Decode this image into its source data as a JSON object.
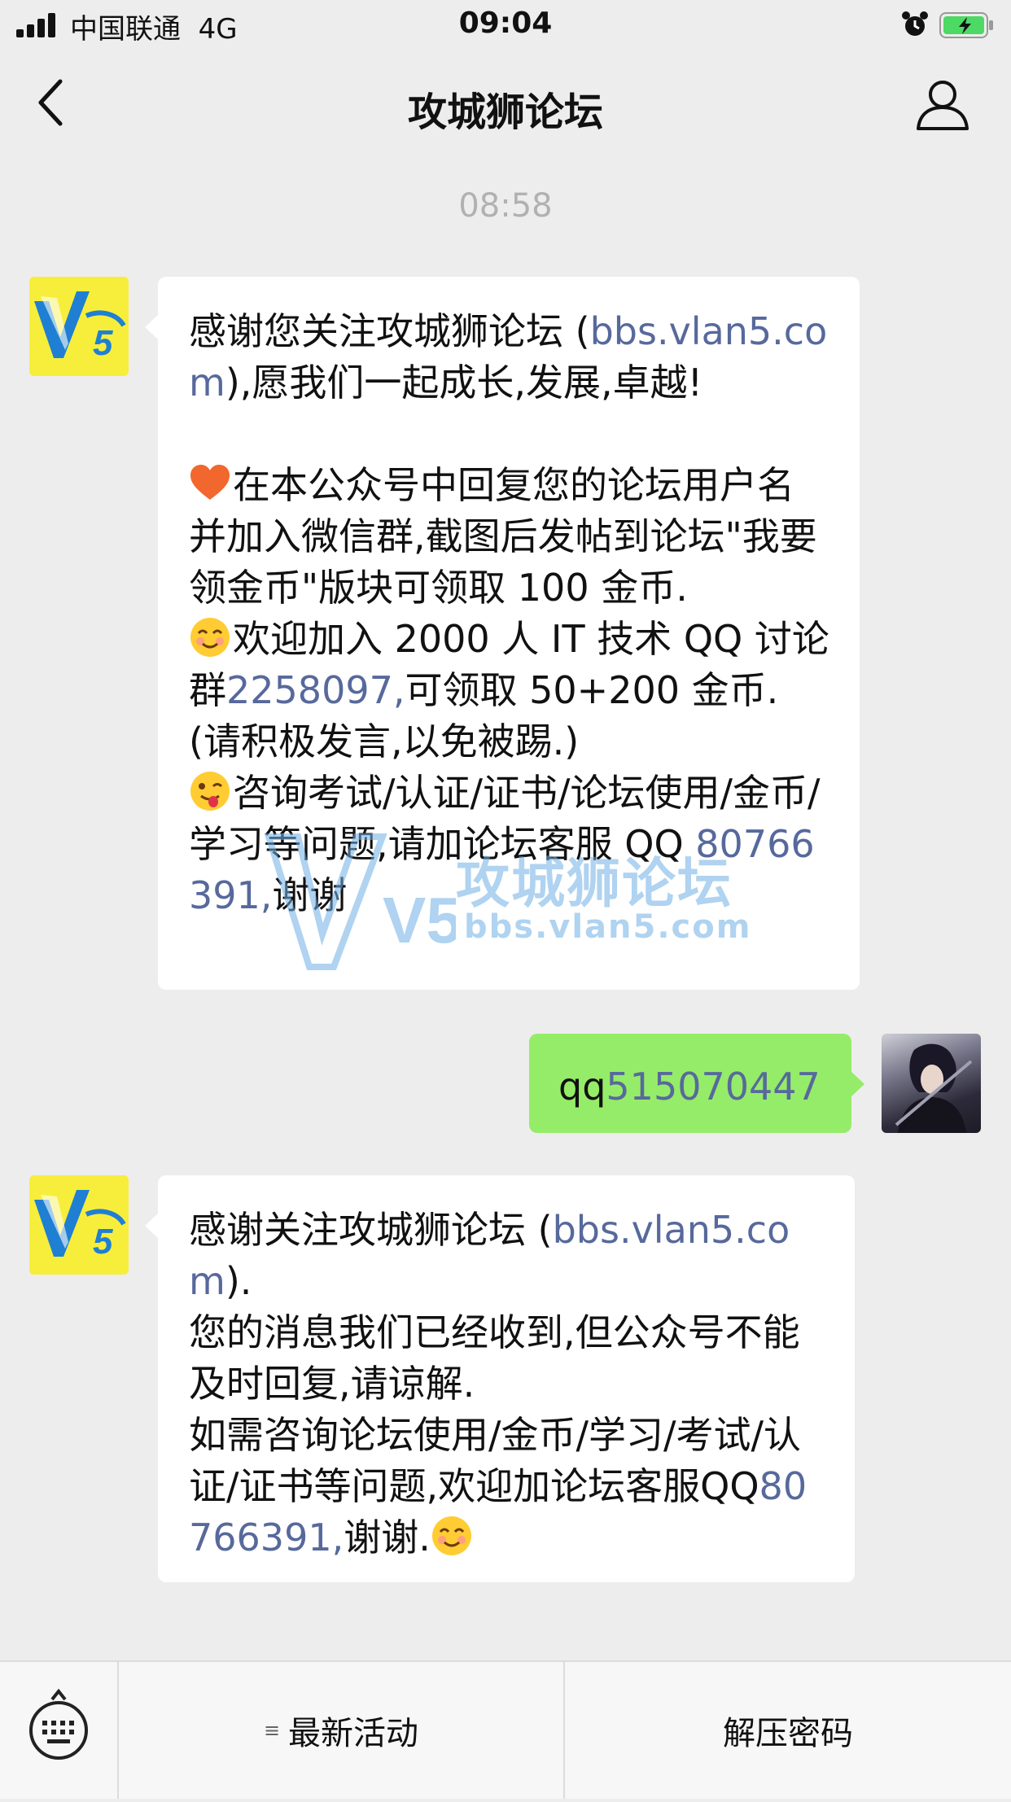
{
  "status_bar": {
    "carrier": "中国联通",
    "network": "4G",
    "time": "09:04"
  },
  "nav": {
    "title": "攻城狮论坛",
    "back_icon": "chevron-left-icon",
    "profile_icon": "person-icon"
  },
  "chat": {
    "timestamp": "08:58",
    "msg1": {
      "p1": "感谢您关注攻城狮论坛 (",
      "link1": "bbs.vlan5.com",
      "p2": "),愿我们一起成长,发展,卓越!",
      "p3": "在本公众号中回复您的论坛用户名并加入微信群,截图后发帖到论坛\"我要领金币\"版块可领取 100 金币.",
      "p4": "欢迎加入 2000 人 IT 技术 QQ 讨论群",
      "qq_group": "2258097,",
      "p5": "可领取 50+200 金币.(请积极发言,以免被踢.)",
      "p6": "咨询考试/认证/证书/论坛使用/金币/学习等问题,请加论坛客服 QQ ",
      "qq_service": "80766391,",
      "p7": "谢谢"
    },
    "msg2": {
      "prefix": "qq",
      "number": "515070447"
    },
    "msg3": {
      "p1": "感谢关注攻城狮论坛 (",
      "link1": "bbs.vlan5.com",
      "p2": ").\n您的消息我们已经收到,但公众号不能及时回复,请谅解.\n如需咨询论坛使用/金币/学习/考试/认证/证书等问题,欢迎加论坛客服QQ",
      "qq_service": "80766391,",
      "p3": "谢谢."
    },
    "watermark": {
      "logo": "V5",
      "text": "攻城狮论坛",
      "url": "bbs.vlan5.com"
    },
    "avatar_text": "V5"
  },
  "bottom_menu": {
    "keyboard_icon": "keyboard-icon",
    "menu_icon": "list-icon",
    "item1": "最新活动",
    "item2": "解压密码"
  },
  "colors": {
    "bubble_right": "#95ec69",
    "link": "#57699c",
    "background": "#ededed"
  }
}
